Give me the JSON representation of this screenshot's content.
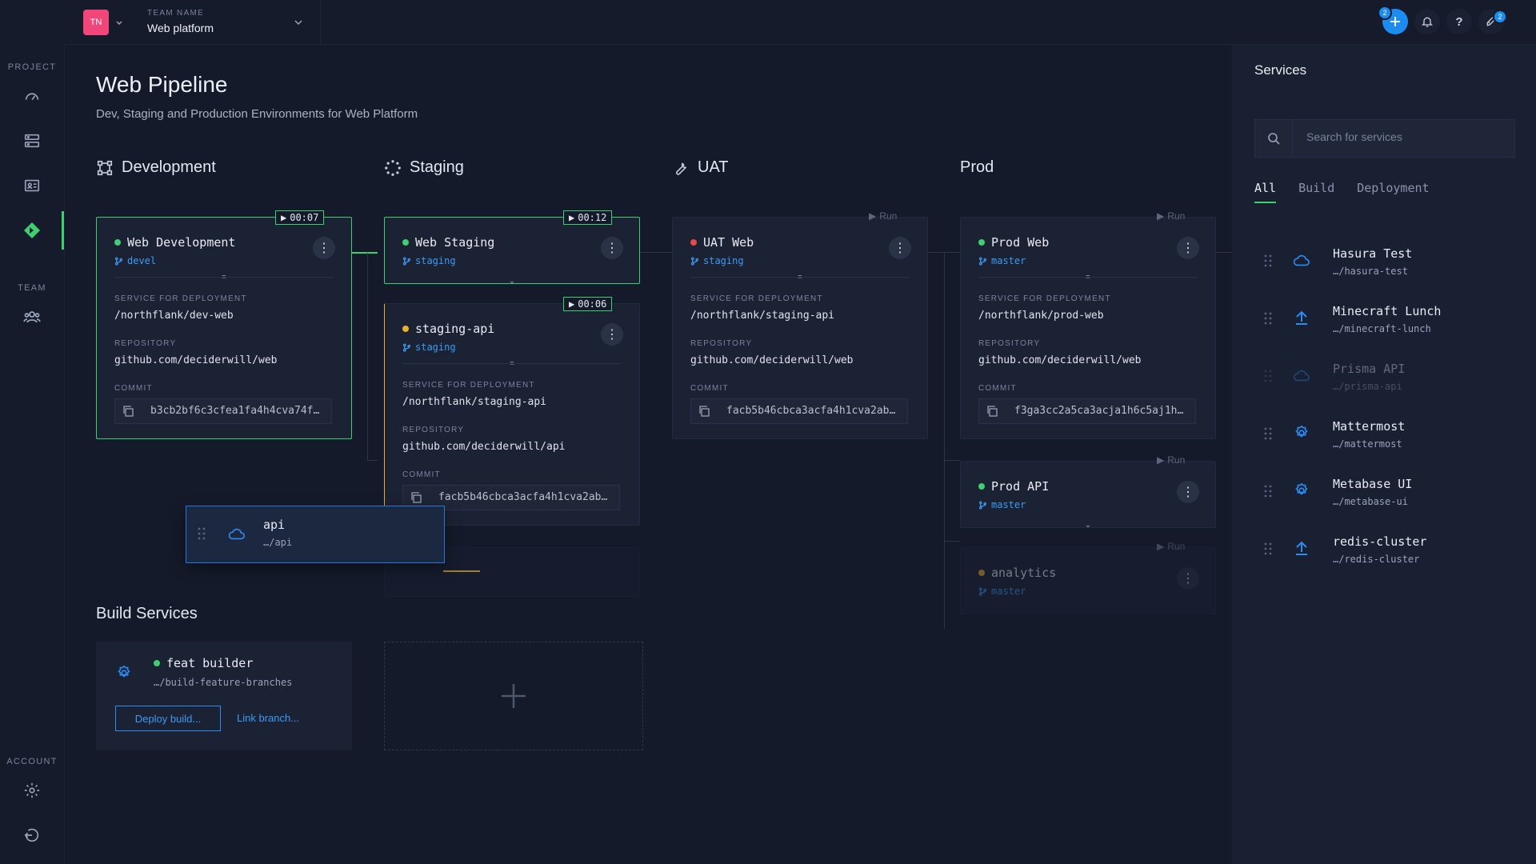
{
  "topbar": {
    "logo_initials": "TN",
    "team_label": "TEAM NAME",
    "team_name": "Web platform",
    "badges": {
      "add": "2",
      "deploy": "2"
    }
  },
  "sidebar": {
    "project_label": "PROJECT",
    "team_label": "TEAM",
    "account_label": "ACCOUNT",
    "items": [
      {
        "icon": "dashboard-icon"
      },
      {
        "icon": "services-icon"
      },
      {
        "icon": "contacts-icon"
      },
      {
        "icon": "pipeline-icon",
        "active": true
      },
      {
        "icon": "team-icon"
      },
      {
        "icon": "settings-icon"
      },
      {
        "icon": "logout-icon"
      }
    ]
  },
  "page": {
    "title": "Web Pipeline",
    "subtitle": "Dev, Staging and Production Environments for Web Platform"
  },
  "columns": [
    {
      "title": "Development",
      "icon": "development-icon"
    },
    {
      "title": "Staging",
      "icon": "staging-icon"
    },
    {
      "title": "UAT",
      "icon": "wrench-icon"
    },
    {
      "title": "Prod",
      "icon": ""
    }
  ],
  "labels": {
    "service_for_deployment": "SERVICE FOR DEPLOYMENT",
    "repository": "REPOSITORY",
    "commit": "COMMIT",
    "run": "Run"
  },
  "cards": {
    "web_development": {
      "name": "Web Development",
      "status": "green",
      "branch": "devel",
      "timer": "00:07",
      "service": "/northflank/dev-web",
      "repository": "github.com/deciderwill/web",
      "commit": "b3cb2bf6c3cfea1fa4h4cva74f…"
    },
    "web_staging": {
      "name": "Web Staging",
      "status": "green",
      "branch": "staging",
      "timer": "00:12"
    },
    "staging_api": {
      "name": "staging-api",
      "status": "yellow",
      "branch": "staging",
      "timer": "00:06",
      "service": "/northflank/staging-api",
      "repository": "github.com/deciderwill/api",
      "commit": "facb5b46cbca3acfa4h1cva2ab…"
    },
    "uat_web": {
      "name": "UAT Web",
      "status": "red",
      "branch": "staging",
      "service": "/northflank/staging-api",
      "repository": "github.com/deciderwill/web",
      "commit": "facb5b46cbca3acfa4h1cva2ab…"
    },
    "prod_web": {
      "name": "Prod Web",
      "status": "green",
      "branch": "master",
      "service": "/northflank/prod-web",
      "repository": "github.com/deciderwill/web",
      "commit": "f3ga3cc2a5ca3acja1h6c5aj1h…"
    },
    "prod_api": {
      "name": "Prod API",
      "status": "green",
      "branch": "master"
    },
    "analytics": {
      "name": "analytics",
      "status": "yellow",
      "branch": "master"
    }
  },
  "drag_card": {
    "name": "api",
    "path": "…/api"
  },
  "build_services": {
    "title": "Build Services",
    "card": {
      "name": "feat builder",
      "path": "…/build-feature-branches",
      "deploy_label": "Deploy build...",
      "link_label": "Link branch..."
    }
  },
  "services_panel": {
    "title": "Services",
    "search_placeholder": "Search for services",
    "tabs": [
      "All",
      "Build",
      "Deployment"
    ],
    "active_tab": "All",
    "items": [
      {
        "name": "Hasura Test",
        "path": "…/hasura-test",
        "icon": "cloud-icon"
      },
      {
        "name": "Minecraft Lunch",
        "path": "…/minecraft-lunch",
        "icon": "upload-icon"
      },
      {
        "name": "Prisma API",
        "path": "…/prisma-api",
        "icon": "cloud-icon",
        "ghost": true
      },
      {
        "name": "Mattermost",
        "path": "…/mattermost",
        "icon": "gear-icon"
      },
      {
        "name": "Metabase UI",
        "path": "…/metabase-ui",
        "icon": "gear-icon"
      },
      {
        "name": "redis-cluster",
        "path": "…/redis-cluster",
        "icon": "upload-icon"
      }
    ]
  },
  "colors": {
    "accent_green": "#3ecf70",
    "accent_blue": "#2c8cf2",
    "warning_yellow": "#e7b02f",
    "error_red": "#e5484d",
    "background": "#141a2a"
  }
}
